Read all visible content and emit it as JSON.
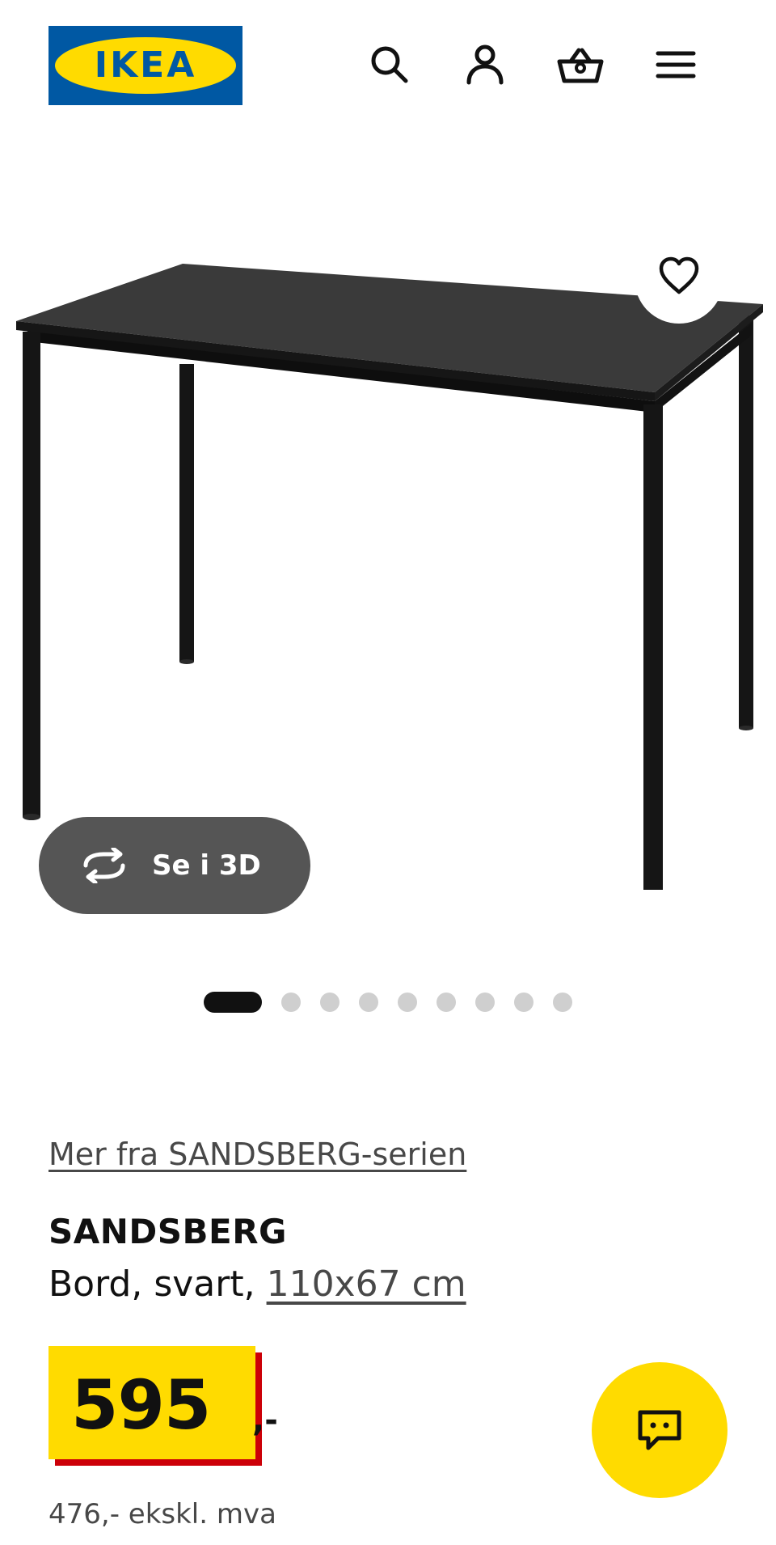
{
  "header": {
    "logo_text": "IKEA",
    "logo_registered": "®",
    "icons": [
      "search-icon",
      "user-icon",
      "basket-icon",
      "menu-icon"
    ]
  },
  "gallery": {
    "favorite_icon": "heart-icon",
    "view_3d_label": "Se i 3D",
    "view_3d_icon": "rotate-3d-icon",
    "dot_count": 9,
    "active_index": 0
  },
  "product": {
    "series_link": "Mer fra SANDSBERG-serien",
    "name": "SANDSBERG",
    "description_prefix": "Bord, svart, ",
    "size_link": "110x67 cm",
    "price": "595",
    "price_suffix": ",-",
    "price_ex_vat": "476,- ekskl. mva"
  },
  "chat": {
    "icon": "chat-icon"
  },
  "colors": {
    "ikea_blue": "#0058a3",
    "ikea_yellow": "#ffdb00",
    "price_shadow_red": "#cc0008",
    "button_grey": "#555555"
  }
}
